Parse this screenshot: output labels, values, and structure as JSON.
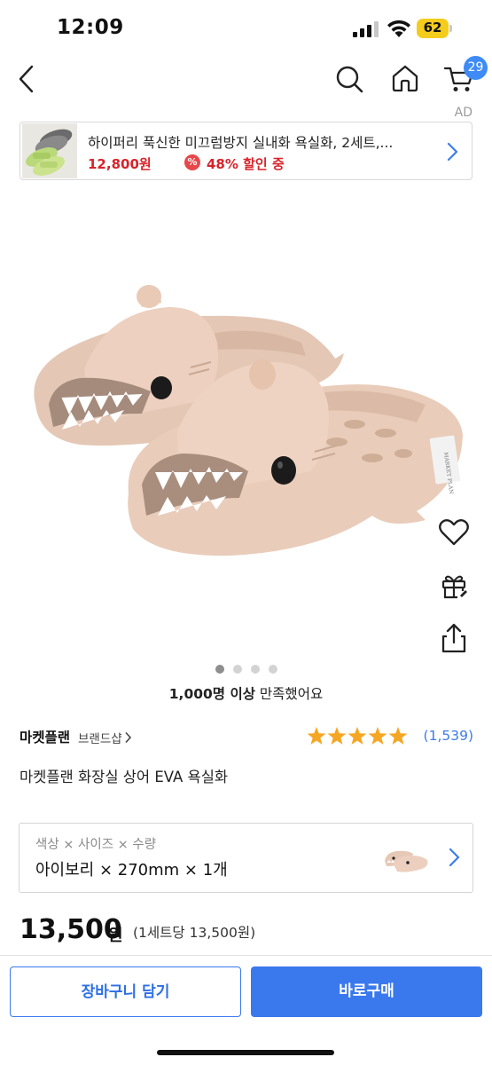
{
  "status_bar": {
    "time": "12:09",
    "battery_percent": "62",
    "icons": [
      "signal-icon",
      "wifi-icon",
      "battery-icon"
    ],
    "battery_color": "#f4cc1c"
  },
  "header": {
    "icons": [
      "back-icon",
      "search-icon",
      "home-icon",
      "cart-icon"
    ],
    "cart_count": "29",
    "badge_color": "#3f8bf6"
  },
  "ad": {
    "label": "AD",
    "title": "하이퍼리 푹신한 미끄럼방지 실내화 욕실화, 2세트,...",
    "price": "12,800원",
    "discount_badge": "%",
    "discount": "48% 할인 중",
    "price_color": "#d8232a"
  },
  "gallery": {
    "current_index": 1,
    "total": 4,
    "side_actions": [
      "heart-icon",
      "gift-icon",
      "share-icon"
    ]
  },
  "satisfaction": {
    "bold": "1,000명 이상",
    "rest": " 만족했어요"
  },
  "seller": {
    "name": "마켓플랜",
    "brand_shop": "브랜드샵",
    "rating_stars": 5,
    "review_count": "(1,539)"
  },
  "product": {
    "title": "마켓플랜 화장실 상어 EVA 욕실화"
  },
  "option": {
    "label": "색상 × 사이즈 × 수량",
    "value": "아이보리 × 270mm × 1개"
  },
  "price": {
    "amount": "13,500",
    "unit": "원",
    "per_set": "(1세트당 13,500원)"
  },
  "buttons": {
    "cart": "장바구니 담기",
    "buy": "바로구매",
    "accent_color": "#3a78ee"
  }
}
